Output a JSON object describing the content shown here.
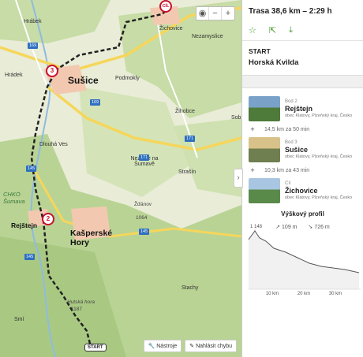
{
  "map": {
    "labels": {
      "sušice": "Sušice",
      "rejštejn": "Rejštejn",
      "kašperské_hory": "Kašperské Hory",
      "žichovice": "Žichovice",
      "nezamyslice": "Nezamyslice",
      "podmokly": "Podmokly",
      "dlouhá_ves": "Dlouhá Ves",
      "žihobce": "Žihobce",
      "nezdice": "Nezdice na Šumavě",
      "strašín": "Strašín",
      "chko": "CHKO Šumava",
      "zdanov": "Žďánov",
      "hrabe": "Hrábek",
      "sobe": "Sob",
      "stachy": "Stachy",
      "smi": "Smí",
      "hradek": "Hrádek",
      "hutska": "Hutská hora",
      "v1064": "1064",
      "v1187": "1187"
    },
    "roads": [
      "169",
      "171",
      "171",
      "145",
      "145",
      "145",
      "169"
    ],
    "pins": {
      "cil": "CÍL",
      "p3": "3",
      "p2": "2",
      "start": "START"
    },
    "zoom": {
      "plus": "+",
      "minus": "−"
    },
    "footer": {
      "tools": "Nástroje",
      "report": "Nahlásit chybu"
    },
    "colors": {
      "route": "#222222",
      "pin": "#c8102e",
      "forest": "#c7dca6",
      "field": "#e9ecd7",
      "water": "#8fbbe0",
      "road": "#f6d65a"
    }
  },
  "panel": {
    "title": "Trasa 38,6 km – 2:29 h",
    "start_label": "START",
    "start_name": "Horská Kvilda",
    "waypoints": [
      {
        "bod": "Bod 2",
        "name": "Rejštejn",
        "sub": "obec Klatovy, Plzeňský kraj, Česko",
        "thumb": [
          "#7aa2c8",
          "#4e7a3a"
        ]
      },
      {
        "bod": "Bod 3",
        "name": "Sušice",
        "sub": "obec Klatovy, Plzeňský kraj, Česko",
        "thumb": [
          "#d9c28a",
          "#6f7f50"
        ]
      },
      {
        "bod": "Cíl",
        "name": "Žichovice",
        "sub": "obec Klatovy, Plzeňský kraj, Česko",
        "thumb": [
          "#a8c6e2",
          "#5a8a4a"
        ]
      }
    ],
    "segments": [
      "14,5 km za 50 min",
      "10,3 km za 43 min"
    ],
    "profile_title": "Výškový profil",
    "ascent": "109 m",
    "descent": "726 m",
    "max_elev": "1 148",
    "ticks": [
      "10 km",
      "20 km",
      "30 km"
    ]
  }
}
